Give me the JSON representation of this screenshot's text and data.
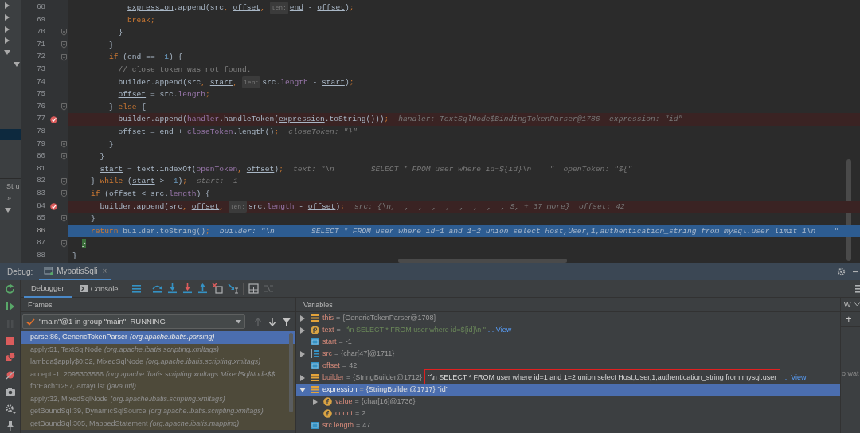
{
  "left_panel": {
    "tree": [
      {
        "expanded": false
      },
      {
        "expanded": false
      },
      {
        "expanded": false
      },
      {
        "expanded": false
      },
      {
        "expanded": true,
        "children": [
          {
            "expanded": true,
            "children": [
              {
                "selected": false
              },
              {
                "selected": false
              },
              {
                "selected": false
              },
              {
                "selected": false
              },
              {
                "selected": false
              },
              {
                "selected": true
              }
            ]
          }
        ]
      }
    ],
    "tab": "Stru",
    "overflow": "»",
    "structure_tree": [
      {
        "expanded": true
      }
    ]
  },
  "editor": {
    "lines": [
      {
        "number": "68",
        "fold_marker": false,
        "breakpoint": false,
        "current": false,
        "tokens": [
          {
            "kind": "local",
            "text": "            expression"
          },
          {
            "kind": "plain",
            "text": ".append(src"
          },
          {
            "kind": "punct",
            "text": ", "
          },
          {
            "kind": "local",
            "text": "offset"
          },
          {
            "kind": "punct",
            "text": ", "
          },
          {
            "kind": "param",
            "text": "len:"
          },
          {
            "kind": "local",
            "text": "end"
          },
          {
            "kind": "plain",
            "text": " - "
          },
          {
            "kind": "local",
            "text": "offset"
          },
          {
            "kind": "plain",
            "text": ")"
          },
          {
            "kind": "punct",
            "text": ";"
          }
        ]
      },
      {
        "number": "69",
        "fold_marker": false,
        "breakpoint": false,
        "current": false,
        "tokens": [
          {
            "kind": "kw",
            "text": "            break"
          },
          {
            "kind": "punct",
            "text": ";"
          }
        ]
      },
      {
        "number": "70",
        "fold_marker": true,
        "breakpoint": false,
        "current": false,
        "tokens": [
          {
            "kind": "plain",
            "text": "          }"
          }
        ]
      },
      {
        "number": "71",
        "fold_marker": true,
        "breakpoint": false,
        "current": false,
        "tokens": [
          {
            "kind": "plain",
            "text": "        }"
          }
        ]
      },
      {
        "number": "72",
        "fold_marker": true,
        "breakpoint": false,
        "current": false,
        "tokens": [
          {
            "kind": "kw",
            "text": "        if "
          },
          {
            "kind": "plain",
            "text": "("
          },
          {
            "kind": "local",
            "text": "end"
          },
          {
            "kind": "plain",
            "text": " == "
          },
          {
            "kind": "num",
            "text": "-1"
          },
          {
            "kind": "plain",
            "text": ") {"
          }
        ]
      },
      {
        "number": "73",
        "fold_marker": false,
        "breakpoint": false,
        "current": false,
        "tokens": [
          {
            "kind": "comment",
            "text": "          // close token was not found."
          }
        ]
      },
      {
        "number": "74",
        "fold_marker": false,
        "breakpoint": false,
        "current": false,
        "tokens": [
          {
            "kind": "plain",
            "text": "          builder.append(src"
          },
          {
            "kind": "punct",
            "text": ", "
          },
          {
            "kind": "local",
            "text": "start"
          },
          {
            "kind": "punct",
            "text": ", "
          },
          {
            "kind": "param",
            "text": "len:"
          },
          {
            "kind": "plain",
            "text": "src."
          },
          {
            "kind": "field",
            "text": "length"
          },
          {
            "kind": "plain",
            "text": " - "
          },
          {
            "kind": "local",
            "text": "start"
          },
          {
            "kind": "plain",
            "text": ")"
          },
          {
            "kind": "punct",
            "text": ";"
          }
        ]
      },
      {
        "number": "75",
        "fold_marker": false,
        "breakpoint": false,
        "current": false,
        "tokens": [
          {
            "kind": "local",
            "text": "          offset"
          },
          {
            "kind": "plain",
            "text": " = src."
          },
          {
            "kind": "field",
            "text": "length"
          },
          {
            "kind": "punct",
            "text": ";"
          }
        ]
      },
      {
        "number": "76",
        "fold_marker": true,
        "breakpoint": false,
        "current": false,
        "tokens": [
          {
            "kind": "plain",
            "text": "        } "
          },
          {
            "kind": "kw",
            "text": "else"
          },
          {
            "kind": "plain",
            "text": " {"
          }
        ]
      },
      {
        "number": "77",
        "fold_marker": false,
        "breakpoint": true,
        "current": false,
        "tokens": [
          {
            "kind": "plain",
            "text": "          builder.append("
          },
          {
            "kind": "field",
            "text": "handler"
          },
          {
            "kind": "plain",
            "text": ".handleToken("
          },
          {
            "kind": "local",
            "text": "expression"
          },
          {
            "kind": "plain",
            "text": ".toString()))"
          },
          {
            "kind": "punct",
            "text": ";"
          }
        ],
        "hint": "handler: TextSqlNode$BindingTokenParser@1786  expression: \"id\""
      },
      {
        "number": "78",
        "fold_marker": false,
        "breakpoint": false,
        "current": false,
        "tokens": [
          {
            "kind": "local",
            "text": "          offset"
          },
          {
            "kind": "plain",
            "text": " = "
          },
          {
            "kind": "local",
            "text": "end"
          },
          {
            "kind": "plain",
            "text": " + "
          },
          {
            "kind": "field",
            "text": "closeToken"
          },
          {
            "kind": "plain",
            "text": ".length()"
          },
          {
            "kind": "punct",
            "text": ";"
          }
        ],
        "hint": "closeToken: \"}\""
      },
      {
        "number": "79",
        "fold_marker": true,
        "breakpoint": false,
        "current": false,
        "tokens": [
          {
            "kind": "plain",
            "text": "        }"
          }
        ]
      },
      {
        "number": "80",
        "fold_marker": true,
        "breakpoint": false,
        "current": false,
        "tokens": [
          {
            "kind": "plain",
            "text": "      }"
          }
        ]
      },
      {
        "number": "81",
        "fold_marker": false,
        "breakpoint": false,
        "current": false,
        "tokens": [
          {
            "kind": "local",
            "text": "      start"
          },
          {
            "kind": "plain",
            "text": " = text.indexOf("
          },
          {
            "kind": "field",
            "text": "openToken"
          },
          {
            "kind": "punct",
            "text": ", "
          },
          {
            "kind": "local",
            "text": "offset"
          },
          {
            "kind": "plain",
            "text": ")"
          },
          {
            "kind": "punct",
            "text": ";"
          }
        ],
        "hint": "text: \"\\n        SELECT * FROM user where id=${id}\\n    \"  openToken: \"${\""
      },
      {
        "number": "82",
        "fold_marker": true,
        "breakpoint": false,
        "current": false,
        "tokens": [
          {
            "kind": "plain",
            "text": "    } "
          },
          {
            "kind": "kw",
            "text": "while"
          },
          {
            "kind": "plain",
            "text": " ("
          },
          {
            "kind": "local",
            "text": "start"
          },
          {
            "kind": "plain",
            "text": " > "
          },
          {
            "kind": "num",
            "text": "-1"
          },
          {
            "kind": "plain",
            "text": ")"
          },
          {
            "kind": "punct",
            "text": ";"
          }
        ],
        "hint": "start: -1"
      },
      {
        "number": "83",
        "fold_marker": true,
        "breakpoint": false,
        "current": false,
        "tokens": [
          {
            "kind": "kw",
            "text": "    if"
          },
          {
            "kind": "plain",
            "text": " ("
          },
          {
            "kind": "local",
            "text": "offset"
          },
          {
            "kind": "plain",
            "text": " < src."
          },
          {
            "kind": "field",
            "text": "length"
          },
          {
            "kind": "plain",
            "text": ") {"
          }
        ]
      },
      {
        "number": "84",
        "fold_marker": false,
        "breakpoint": true,
        "current": false,
        "tokens": [
          {
            "kind": "plain",
            "text": "      builder.append(src"
          },
          {
            "kind": "punct",
            "text": ", "
          },
          {
            "kind": "local",
            "text": "offset"
          },
          {
            "kind": "punct",
            "text": ", "
          },
          {
            "kind": "param",
            "text": "len:"
          },
          {
            "kind": "plain",
            "text": "src."
          },
          {
            "kind": "field",
            "text": "length"
          },
          {
            "kind": "plain",
            "text": " - "
          },
          {
            "kind": "local",
            "text": "offset"
          },
          {
            "kind": "plain",
            "text": ")"
          },
          {
            "kind": "punct",
            "text": ";"
          }
        ],
        "hint": "src: {\\n,  ,  ,  ,  ,  ,  ,  ,  , S, + 37 more}  offset: 42"
      },
      {
        "number": "85",
        "fold_marker": true,
        "breakpoint": false,
        "current": false,
        "tokens": [
          {
            "kind": "plain",
            "text": "    }"
          }
        ]
      },
      {
        "number": "86",
        "fold_marker": false,
        "breakpoint": false,
        "current": true,
        "tokens": [
          {
            "kind": "kw",
            "text": "    return"
          },
          {
            "kind": "plain",
            "text": " builder.toString()"
          },
          {
            "kind": "punct",
            "text": ";"
          }
        ],
        "hint": "builder: \"\\n        SELECT * FROM user where id=1 and 1=2 union select Host,User,1,authentication_string from mysql.user limit 1\\n    \""
      },
      {
        "number": "87",
        "fold_marker": true,
        "breakpoint": false,
        "current": false,
        "tokens": [
          {
            "kind": "match",
            "text": "  }"
          }
        ]
      },
      {
        "number": "88",
        "fold_marker": false,
        "breakpoint": false,
        "current": false,
        "tokens": [
          {
            "kind": "plain",
            "text": "}"
          }
        ]
      }
    ]
  },
  "debug": {
    "label": "Debug:",
    "tab": {
      "title": "MybatisSqli",
      "close": "×"
    },
    "tabs": [
      {
        "label": "Debugger",
        "selected": true,
        "kind": "plain"
      },
      {
        "label": "Console",
        "selected": false,
        "kind": "console"
      }
    ],
    "toolbar": [
      {
        "kind": "layout",
        "disabled": false
      },
      {
        "kind": "step-over",
        "disabled": false
      },
      {
        "kind": "step-into",
        "disabled": false
      },
      {
        "kind": "force-step-into",
        "disabled": false
      },
      {
        "kind": "step-out",
        "disabled": false
      },
      {
        "kind": "drop-frame",
        "disabled": false
      },
      {
        "kind": "run-to-cursor",
        "disabled": false
      },
      {
        "kind": "evaluate",
        "disabled": false
      },
      {
        "kind": "trace",
        "disabled": true
      }
    ],
    "side_toolbar": [
      {
        "kind": "rerun",
        "disabled": false
      },
      {
        "kind": "resume",
        "disabled": false
      },
      {
        "kind": "pause",
        "disabled": true
      },
      {
        "kind": "stop",
        "disabled": false
      },
      {
        "kind": "breakpoints",
        "disabled": false
      },
      {
        "kind": "mute",
        "disabled": false
      },
      {
        "kind": "camera",
        "disabled": false
      },
      {
        "kind": "settings",
        "disabled": false
      },
      {
        "kind": "pin",
        "disabled": false
      }
    ],
    "frames": {
      "title": "Frames",
      "thread": "\"main\"@1 in group \"main\": RUNNING",
      "nav": [
        {
          "kind": "up",
          "disabled": true
        },
        {
          "kind": "down",
          "disabled": false
        },
        {
          "kind": "filter",
          "disabled": false
        }
      ],
      "items": [
        {
          "method": "parse:86, GenericTokenParser",
          "package": "(org.apache.ibatis.parsing)",
          "selected": true,
          "library": false
        },
        {
          "method": "apply:51, TextSqlNode",
          "package": "(org.apache.ibatis.scripting.xmltags)",
          "selected": false,
          "library": true
        },
        {
          "method": "lambda$apply$0:32, MixedSqlNode",
          "package": "(org.apache.ibatis.scripting.xmltags)",
          "selected": false,
          "library": true
        },
        {
          "method": "accept:-1, 2095303566",
          "package": "(org.apache.ibatis.scripting.xmltags.MixedSqlNode$$",
          "selected": false,
          "library": true
        },
        {
          "method": "forEach:1257, ArrayList",
          "package": "(java.util)",
          "selected": false,
          "library": true
        },
        {
          "method": "apply:32, MixedSqlNode",
          "package": "(org.apache.ibatis.scripting.xmltags)",
          "selected": false,
          "library": true
        },
        {
          "method": "getBoundSql:39, DynamicSqlSource",
          "package": "(org.apache.ibatis.scripting.xmltags)",
          "selected": false,
          "library": true
        },
        {
          "method": "getBoundSql:305, MappedStatement",
          "package": "(org.apache.ibatis.mapping)",
          "selected": false,
          "library": true
        }
      ]
    },
    "variables": {
      "title": "Variables",
      "items": [
        {
          "kind": "object",
          "name": "this",
          "eq": "=",
          "value": "{GenericTokenParser@1708}",
          "expanded": false,
          "selected": false
        },
        {
          "kind": "param",
          "name": "text",
          "eq": "=",
          "string": "\"\\n        SELECT * FROM user where id=${id}\\n    \"",
          "link": "... View",
          "expanded": false,
          "selected": false
        },
        {
          "kind": "primitive",
          "name": "start",
          "eq": "=",
          "value": "-1",
          "selected": false
        },
        {
          "kind": "array",
          "name": "src",
          "eq": "=",
          "value": "{char[47]@1711}",
          "expanded": false,
          "selected": false
        },
        {
          "kind": "primitive",
          "name": "offset",
          "eq": "=",
          "value": "42",
          "selected": false
        },
        {
          "kind": "object",
          "name": "builder",
          "eq": "=",
          "value": "{StringBuilder@1712}",
          "string": "\"\\n        SELECT * FROM user where id=1 and 1=2 union select Host,User,1,authentication_string from mysql.user",
          "link": "... View",
          "boxed": true,
          "expanded": false,
          "selected": false
        },
        {
          "kind": "object",
          "name": "expression",
          "eq": "=",
          "value": "{StringBuilder@1717}",
          "string": "\"id\"",
          "expanded": true,
          "selected": true,
          "children": [
            {
              "kind": "field",
              "name": "value",
              "eq": "=",
              "value": "{char[16]@1736}",
              "expanded": false,
              "selected": false
            },
            {
              "kind": "field",
              "name": "count",
              "eq": "=",
              "value": "2",
              "selected": false
            }
          ]
        },
        {
          "kind": "primitive",
          "name": "src.length",
          "eq": "=",
          "value": "47",
          "selected": false
        }
      ]
    },
    "watches": {
      "title": "W",
      "add": "+",
      "empty_text": "o wat"
    }
  }
}
